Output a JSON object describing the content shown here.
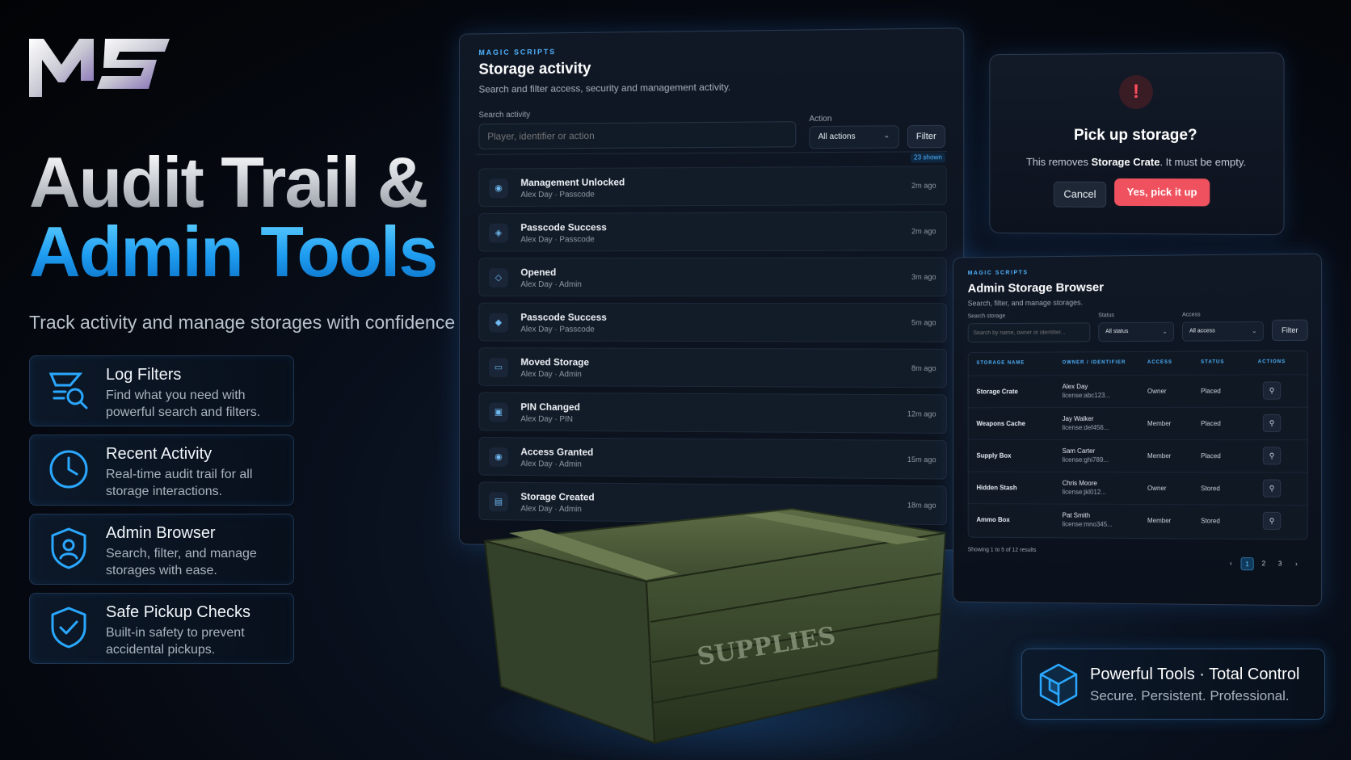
{
  "brand": {
    "logo_text": "MS"
  },
  "hero": {
    "line1": "Audit Trail &",
    "line2": "Admin Tools",
    "subtitle": "Track activity and manage storages with confidence"
  },
  "features": [
    {
      "icon": "log-filter-icon",
      "title": "Log Filters",
      "description": "Find what you need with powerful search and filters."
    },
    {
      "icon": "clock-icon",
      "title": "Recent Activity",
      "description": "Real-time audit trail for all storage interactions."
    },
    {
      "icon": "user-shield-icon",
      "title": "Admin Browser",
      "description": "Search, filter, and manage storages with ease."
    },
    {
      "icon": "check-shield-icon",
      "title": "Safe Pickup Checks",
      "description": "Built-in safety to prevent accidental pickups."
    }
  ],
  "activity_panel": {
    "brand": "MAGIC SCRIPTS",
    "title": "Storage activity",
    "subtitle": "Search and filter access, security and management activity.",
    "search_label": "Search activity",
    "search_placeholder": "Player, identifier or action",
    "action_label": "Action",
    "action_value": "All actions",
    "filter_label": "Filter",
    "shown_badge": "23 shown",
    "rows": [
      {
        "icon": "user-icon",
        "title": "Management Unlocked",
        "meta": "Alex Day · Passcode",
        "time": "2m ago"
      },
      {
        "icon": "shield-icon",
        "title": "Passcode Success",
        "meta": "Alex Day · Passcode",
        "time": "2m ago"
      },
      {
        "icon": "unlock-icon",
        "title": "Opened",
        "meta": "Alex Day · Admin",
        "time": "3m ago"
      },
      {
        "icon": "lock-icon",
        "title": "Passcode Success",
        "meta": "Alex Day · Passcode",
        "time": "5m ago"
      },
      {
        "icon": "folder-icon",
        "title": "Moved Storage",
        "meta": "Alex Day · Admin",
        "time": "8m ago"
      },
      {
        "icon": "pin-icon",
        "title": "PIN Changed",
        "meta": "Alex Day · PIN",
        "time": "12m ago"
      },
      {
        "icon": "user-icon",
        "title": "Access Granted",
        "meta": "Alex Day · Admin",
        "time": "15m ago"
      },
      {
        "icon": "box-icon",
        "title": "Storage Created",
        "meta": "Alex Day · Admin",
        "time": "18m ago"
      }
    ]
  },
  "crate": {
    "label": "SUPPLIES"
  },
  "dialog": {
    "icon": "!",
    "title": "Pick up storage?",
    "text_before": "This removes ",
    "text_bold": "Storage Crate",
    "text_after": ". It must be empty.",
    "cancel_label": "Cancel",
    "confirm_label": "Yes, pick it up"
  },
  "admin_browser": {
    "brand": "MAGIC SCRIPTS",
    "title": "Admin Storage Browser",
    "subtitle": "Search, filter, and manage storages.",
    "search_label": "Search storage",
    "search_placeholder": "Search by name, owner or identifier...",
    "status_label": "Status",
    "status_value": "All status",
    "access_label": "Access",
    "access_value": "All access",
    "filter_label": "Filter",
    "columns": [
      "STORAGE NAME",
      "OWNER / IDENTIFIER",
      "ACCESS",
      "STATUS",
      "ACTIONS"
    ],
    "rows": [
      {
        "name": "Storage Crate",
        "owner": "Alex Day",
        "license": "license:abc123...",
        "access": "Owner",
        "status": "Placed"
      },
      {
        "name": "Weapons Cache",
        "owner": "Jay Walker",
        "license": "license:def456...",
        "access": "Member",
        "status": "Placed"
      },
      {
        "name": "Supply Box",
        "owner": "Sam Carter",
        "license": "license:ghi789...",
        "access": "Member",
        "status": "Placed"
      },
      {
        "name": "Hidden Stash",
        "owner": "Chris Moore",
        "license": "license:jkl012...",
        "access": "Owner",
        "status": "Stored"
      },
      {
        "name": "Ammo Box",
        "owner": "Pat Smith",
        "license": "license:mno345...",
        "access": "Member",
        "status": "Stored"
      }
    ],
    "footer": "Showing 1 to 5 of 12 results",
    "pages": [
      "‹",
      "1",
      "2",
      "3",
      "›"
    ]
  },
  "badge": {
    "title": "Powerful Tools · Total Control",
    "subtitle": "Secure. Persistent. Professional."
  },
  "colors": {
    "accent": "#1e9cf0",
    "danger": "#f0515f",
    "background": "#05080f"
  }
}
